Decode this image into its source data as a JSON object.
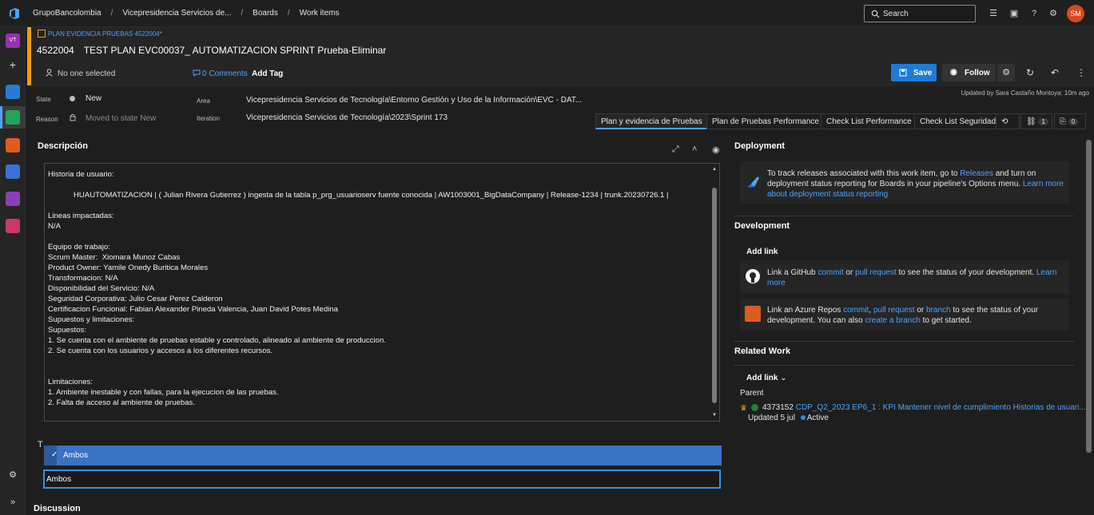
{
  "breadcrumbs": [
    "GrupoBancolombia",
    "Vicepresidencia Servicios de...",
    "Boards",
    "Work items"
  ],
  "search": {
    "placeholder": "Search"
  },
  "user": {
    "initials": "SM"
  },
  "leftnav": {
    "project_initials": "VT"
  },
  "work_item": {
    "type_label": "PLAN EVIDENCIA PRUEBAS 4522004*",
    "id": "4522004",
    "title": "TEST PLAN EVC00037_ AUTOMATIZACION SPRINT Prueba-Eliminar",
    "assigned": "No one selected",
    "comments": "0 Comments",
    "add_tag": "Add Tag",
    "updated": "Updated by Sara Castaño Montoya: 10m ago"
  },
  "toolbar": {
    "save_label": "Save",
    "follow_label": "Follow"
  },
  "fields": {
    "state_label": "State",
    "state_value": "New",
    "reason_label": "Reason",
    "reason_value": "Moved to state New",
    "area_label": "Area",
    "area_value": "Vicepresidencia Servicios de Tecnología\\Entorno Gestión y Uso de la Información\\EVC - DAT...",
    "iteration_label": "Iteration",
    "iteration_value": "Vicepresidencia Servicios de Tecnología\\2023\\Sprint 173"
  },
  "tabs": [
    {
      "label": "Plan y evidencia de Pruebas"
    },
    {
      "label": "Plan de Pruebas Performance"
    },
    {
      "label": "Check List Performance"
    },
    {
      "label": "Check List Seguridad"
    }
  ],
  "tab_counts": {
    "links": "1",
    "attachments": "0"
  },
  "description": {
    "title": "Descripción",
    "body": "Historia de usuario:\n\n            HUAUTOMATIZACION | ( Julian Rivera Gutierrez ) ingesta de la tabla p_prg_usuarioserv fuente conocida | AW1003001_BigDataCompany | Release-1234 | trunk.20230726.1 |\n\nLineas impactadas:\nN/A\n\nEquipo de trabajo:\nScrum Master:  Xiomara Munoz Cabas\nProduct Owner: Yamile Onedy Buritica Morales\nTransformacion: N/A\nDisponibilidad del Servicio: N/A\nSeguridad Corporativa: Julio Cesar Perez Calderon\nCertificacion Funcional: Fabian Alexander Pineda Valencia, Juan David Potes Medina\nSupuestos y limitaciones:\nSupuestos:\n1. Se cuenta con el ambiente de pruebas estable y controlado, alineado al ambiente de produccion.\n2. Se cuenta con los usuarios y accesos a los diferentes recursos.\n\n\nLimitaciones:\n1. Ambiente inestable y con fallas, para la ejecucion de las pruebas.\n2. Falta de acceso al ambiente de pruebas."
  },
  "field_t": {
    "label_fragment": "T",
    "dropdown_option": "Ambos",
    "input_value": "Ambos"
  },
  "discussion": {
    "title": "Discussion"
  },
  "deployment": {
    "title": "Deployment",
    "text_pre": "To track releases associated with this work item, go to ",
    "releases_link": "Releases",
    "text_mid": " and turn on deployment status reporting for Boards in your pipeline's Options menu. ",
    "learn_link": "Learn more about deployment status reporting"
  },
  "development": {
    "title": "Development",
    "add_link": "Add link",
    "github_pre": "Link a GitHub ",
    "github_commit": "commit",
    "github_or": " or ",
    "github_pr": "pull request",
    "github_post": " to see the status of your development. ",
    "github_learn": "Learn more",
    "azure_pre": "Link an Azure Repos ",
    "azure_commit": "commit",
    "azure_sep": ", ",
    "azure_pr": "pull request",
    "azure_or": " or ",
    "azure_branch": "branch",
    "azure_mid": " to see the status of your development. You can also ",
    "azure_create": "create a branch",
    "azure_post": " to get started."
  },
  "related": {
    "title": "Related Work",
    "add_link": "Add link",
    "parent_label": "Parent",
    "parent_id": "4373152",
    "parent_title": "CDP_Q2_2023 EP6_1 : KPI Mantener nivel de cumplimiento Historias de usuari...",
    "parent_updated": "Updated 5 jul",
    "parent_state": "Active"
  }
}
